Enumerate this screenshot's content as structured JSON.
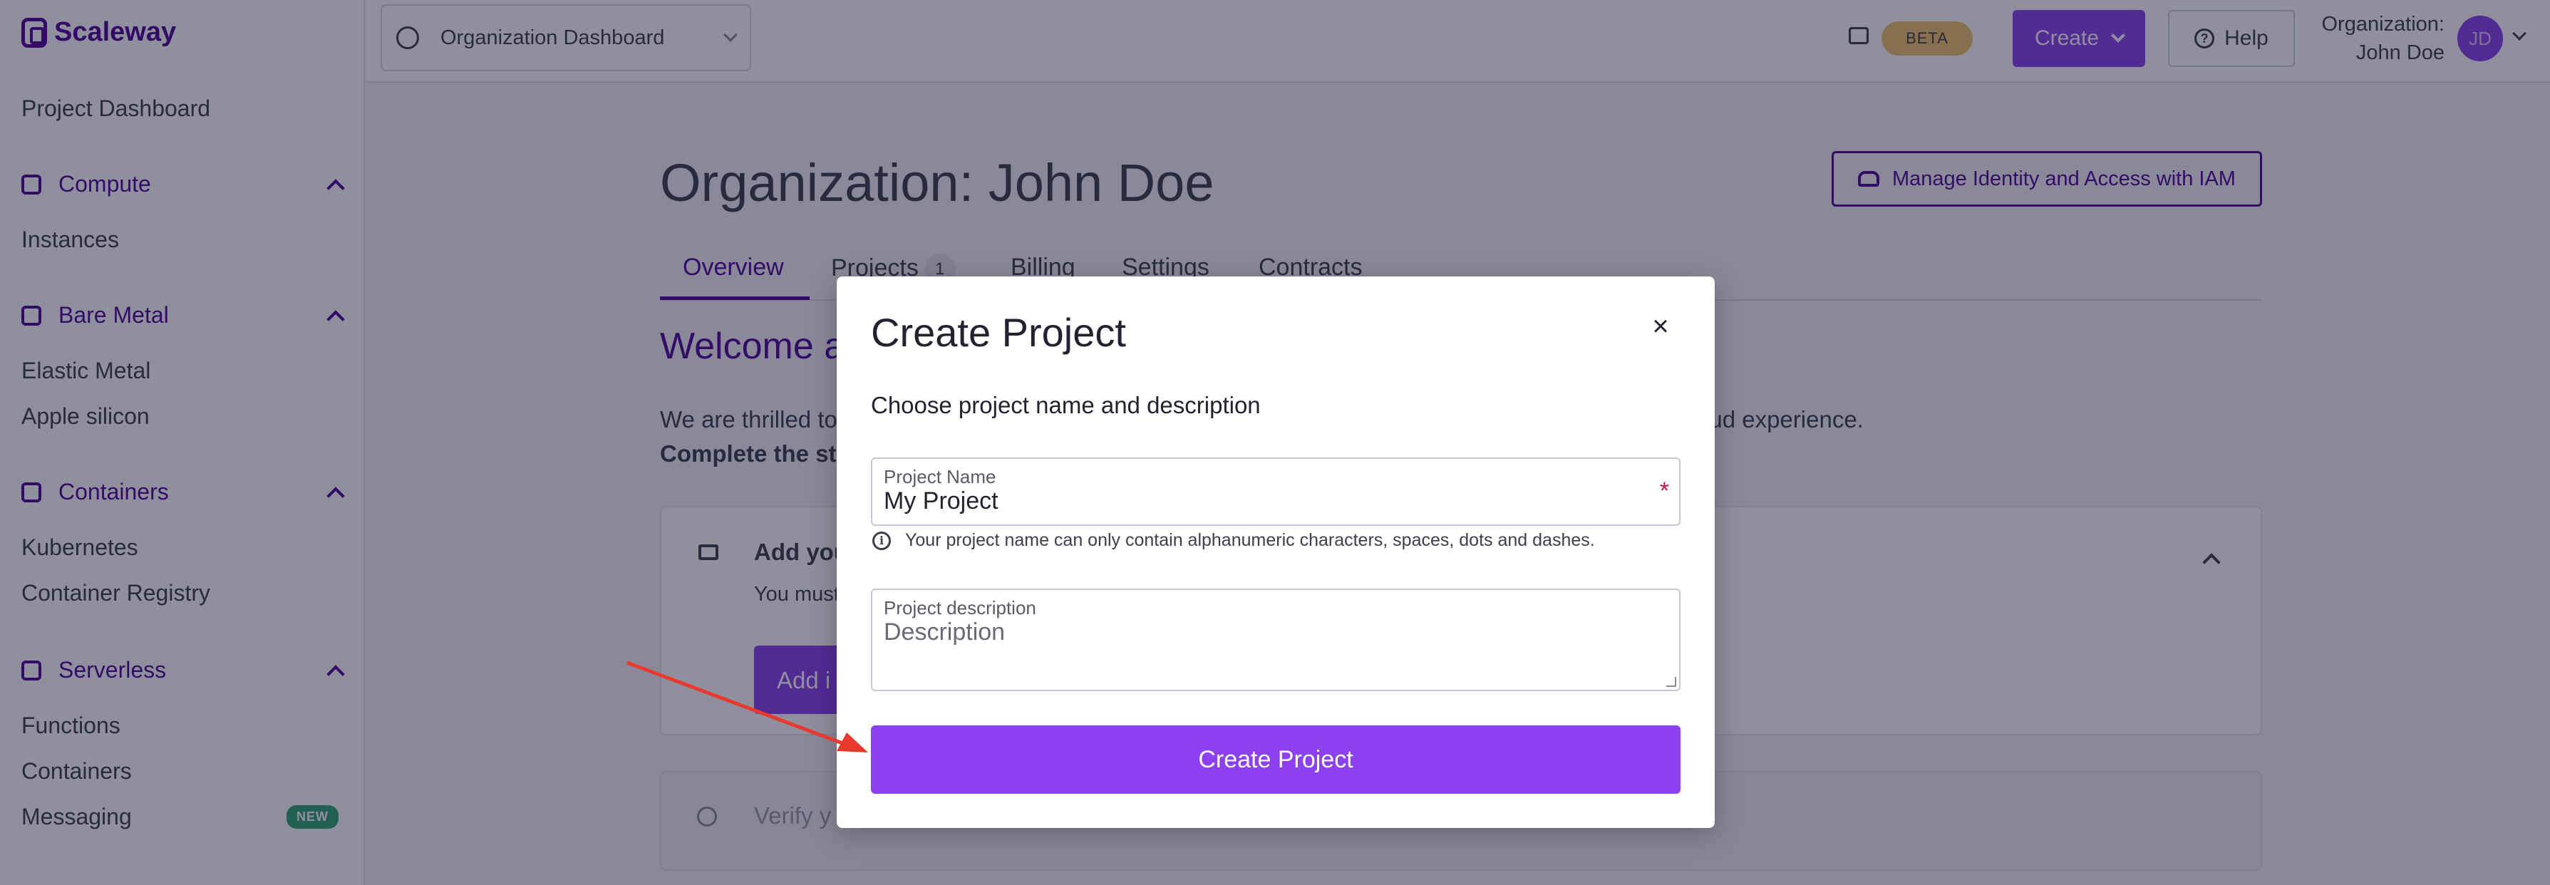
{
  "brand": {
    "name": "Scaleway"
  },
  "sidebar": {
    "dashboard_link": "Project Dashboard",
    "sections": [
      {
        "label": "Compute",
        "items": [
          "Instances"
        ]
      },
      {
        "label": "Bare Metal",
        "items": [
          "Elastic Metal",
          "Apple silicon"
        ]
      },
      {
        "label": "Containers",
        "items": [
          "Kubernetes",
          "Container Registry"
        ]
      },
      {
        "label": "Serverless",
        "items": [
          "Functions",
          "Containers",
          "Messaging"
        ]
      }
    ],
    "new_badge": "NEW"
  },
  "topbar": {
    "org_selector": "Organization Dashboard",
    "beta_badge": "BETA",
    "create_label": "Create",
    "help_label": "Help",
    "org_label": "Organization:",
    "user_name": "John Doe",
    "avatar_initials": "JD"
  },
  "main": {
    "title": "Organization: John Doe",
    "iam_button": "Manage Identity and Access with IAM",
    "tabs": [
      {
        "label": "Overview"
      },
      {
        "label": "Projects",
        "count": "1"
      },
      {
        "label": "Billing"
      },
      {
        "label": "Settings"
      },
      {
        "label": "Contracts"
      }
    ],
    "welcome_partial": "Welcome a",
    "intro_line1_start": "We are thrilled to",
    "intro_line1_end": "oud experience.",
    "intro_line2_partial": "Complete the st",
    "step1_title_partial": "Add you",
    "step1_desc_partial": "You must",
    "step1_button_partial": "Add i",
    "step2_title_partial": "Verify y"
  },
  "modal": {
    "title": "Create Project",
    "close_symbol": "×",
    "subtitle": "Choose project name and description",
    "name_label": "Project Name",
    "name_value": "My Project",
    "required_mark": "*",
    "hint_icon": "i",
    "hint": "Your project name can only contain alphanumeric characters, spaces, dots and dashes.",
    "desc_label": "Project description",
    "desc_placeholder": "Description",
    "submit_label": "Create Project"
  },
  "colors": {
    "brand_purple": "#4f0599",
    "button_purple": "#8c40ef",
    "annotation_arrow": "#e8392f",
    "beta_gold": "#f0c46a",
    "new_green": "#31a56d"
  },
  "icons": [
    "scaleway-logo-icon",
    "compute-icon",
    "bare-metal-icon",
    "containers-icon",
    "serverless-icon",
    "org-dashboard-icon",
    "terminal-icon",
    "help-icon",
    "people-icon",
    "credit-card-icon",
    "check-circle-icon",
    "close-icon",
    "info-icon"
  ]
}
